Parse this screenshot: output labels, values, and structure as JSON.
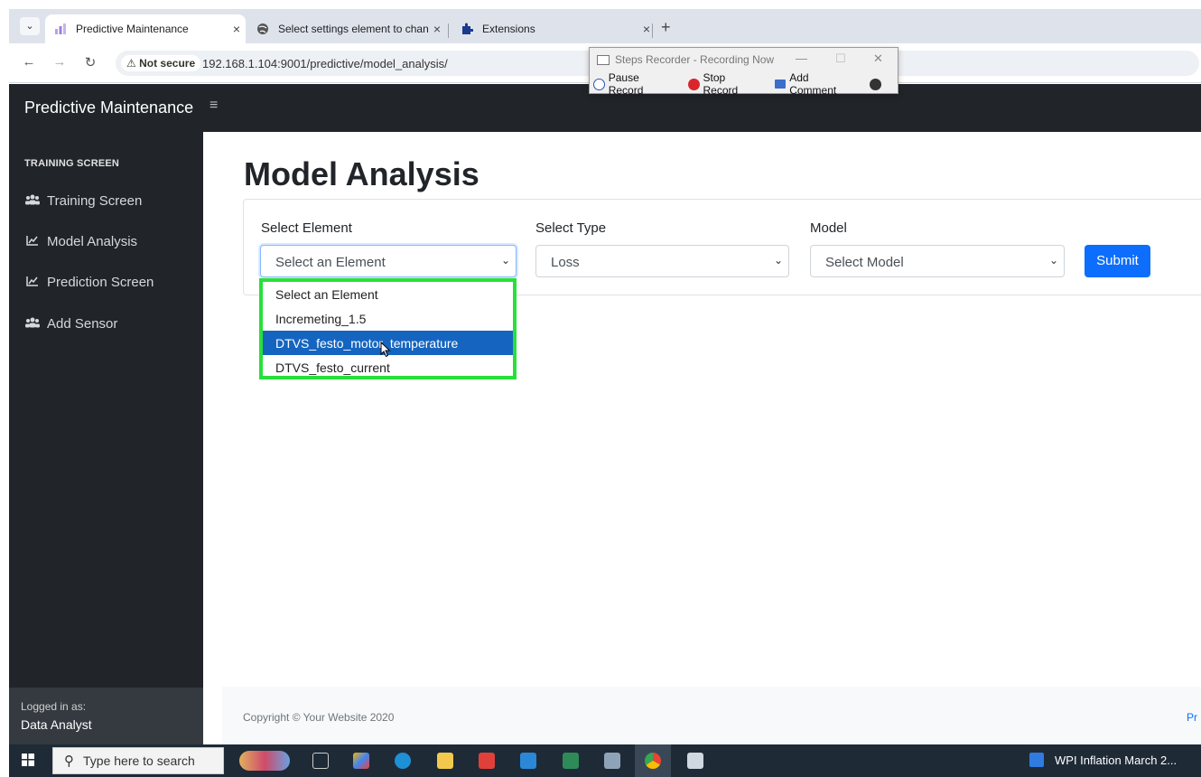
{
  "browser": {
    "tabs": [
      {
        "title": "Predictive Maintenance",
        "active": true
      },
      {
        "title": "Select settings element to chan",
        "active": false
      },
      {
        "title": "Extensions",
        "active": false
      }
    ],
    "not_secure_label": "Not secure",
    "url": "192.168.1.104:9001/predictive/model_analysis/",
    "tab_close": "×",
    "new_tab": "+"
  },
  "recorder": {
    "title": "Steps Recorder - Recording Now",
    "pause": "Pause Record",
    "stop": "Stop Record",
    "comment": "Add Comment"
  },
  "app": {
    "brand": "Predictive Maintenance",
    "burger": "≡"
  },
  "sidebar": {
    "heading": "TRAINING SCREEN",
    "items": [
      {
        "label": "Training Screen",
        "icon": "users-icon"
      },
      {
        "label": "Model Analysis",
        "icon": "chart-area-icon"
      },
      {
        "label": "Prediction Screen",
        "icon": "chart-area-icon"
      },
      {
        "label": "Add Sensor",
        "icon": "users-icon"
      }
    ],
    "logged_in_label": "Logged in as:",
    "user": "Data Analyst"
  },
  "main": {
    "title": "Model Analysis",
    "element_label": "Select Element",
    "element_value": "Select an Element",
    "type_label": "Select Type",
    "type_value": "Loss",
    "model_label": "Model",
    "model_value": "Select Model",
    "submit_label": "Submit",
    "dropdown_options": [
      "Select an Element",
      "Incremeting_1.5",
      "DTVS_festo_motor_temperature",
      "DTVS_festo_current"
    ],
    "selected_option_index": 2
  },
  "footer": {
    "copyright": "Copyright © Your Website 2020",
    "right": "Pr"
  },
  "taskbar": {
    "search_placeholder": "Type here to search",
    "right_app": "WPI Inflation March 2..."
  },
  "colors": {
    "dark_nav": "#212529",
    "primary": "#0d6efd",
    "highlight": "#28e03a",
    "selected_option": "#1565c0"
  }
}
